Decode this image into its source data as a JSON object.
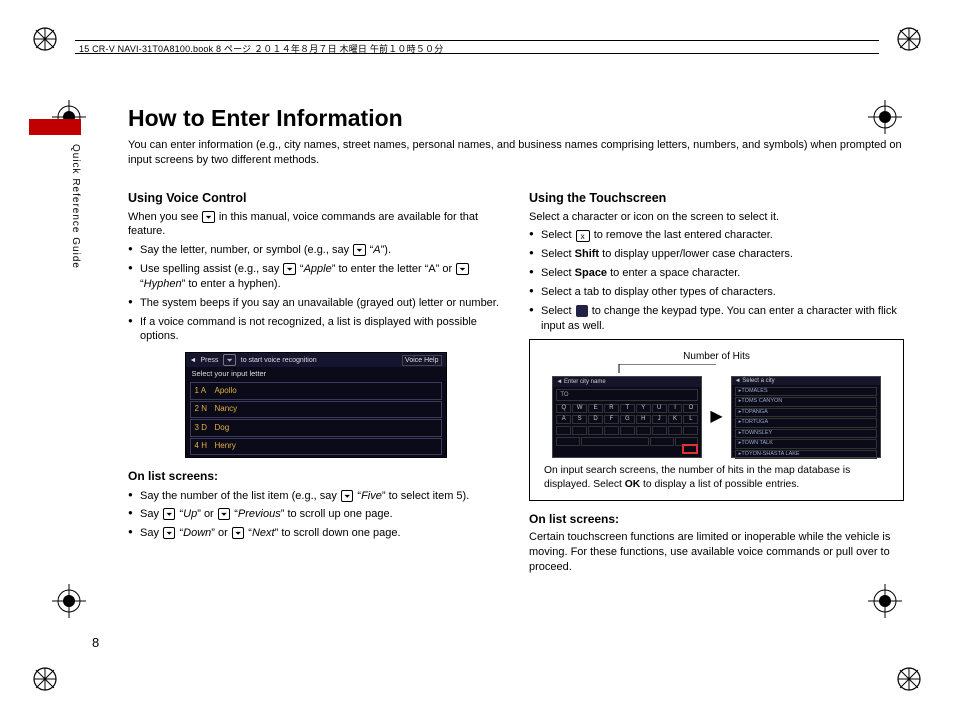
{
  "meta": {
    "running_head": "15 CR-V NAVI-31T0A8100.book  8 ページ  ２０１４年８月７日  木曜日  午前１０時５０分"
  },
  "sidebar": {
    "guide_label": "Quick Reference Guide"
  },
  "page_number": "8",
  "title": "How to Enter Information",
  "intro": "You can enter information (e.g., city names, street names, personal names, and business names comprising letters, numbers, and symbols) when prompted on input screens by two different methods.",
  "left": {
    "h2": "Using Voice Control",
    "lead_a": "When you see ",
    "lead_b": " in this manual, voice commands are available for that feature.",
    "b1_a": "Say the letter, number, or symbol (e.g., say ",
    "b1_b": " “",
    "b1_c": "A",
    "b1_d": "”).",
    "b2_a": "Use spelling assist (e.g., say ",
    "b2_b": " “",
    "b2_c": "Apple",
    "b2_d": "” to enter the letter “A” or ",
    "b2_e": " “",
    "b2_f": "Hyphen",
    "b2_g": "” to enter a hyphen).",
    "b3": "The system beeps if you say an unavailable (grayed out) letter or number.",
    "b4": "If a voice command is not recognized, a list is displayed with possible options.",
    "screenshot": {
      "header_a": "Press",
      "header_b": "to start voice recognition",
      "header_c": "Voice Help",
      "sub": "Select your input letter",
      "rows": [
        {
          "n": "1",
          "l": "A",
          "w": "Apollo"
        },
        {
          "n": "2",
          "l": "N",
          "w": "Nancy"
        },
        {
          "n": "3",
          "l": "D",
          "w": "Dog"
        },
        {
          "n": "4",
          "l": "H",
          "w": "Henry"
        }
      ]
    },
    "h3": "On list screens:",
    "c1_a": "Say the number of the list item (e.g., say ",
    "c1_b": " “",
    "c1_c": "Five",
    "c1_d": "” to select item 5).",
    "c2_a": "Say ",
    "c2_b": " “",
    "c2_c": "Up",
    "c2_d": "” or ",
    "c2_e": " “",
    "c2_f": "Previous",
    "c2_g": "” to scroll up one page.",
    "c3_a": "Say ",
    "c3_b": " “",
    "c3_c": "Down",
    "c3_d": "” or ",
    "c3_e": " “",
    "c3_f": "Next",
    "c3_g": "” to scroll down one page."
  },
  "right": {
    "h2": "Using the Touchscreen",
    "lead": "Select a character or icon on the screen to select it.",
    "b1_a": "Select ",
    "b1_key": "x",
    "b1_b": " to remove the last entered character.",
    "b2_a": "Select ",
    "b2_bold": "Shift",
    "b2_b": " to display upper/lower case characters.",
    "b3_a": "Select ",
    "b3_bold": "Space",
    "b3_b": " to enter a space character.",
    "b4": "Select a tab to display other types of characters.",
    "b5_a": "Select ",
    "b5_b": " to change the keypad type. You can enter a character with flick input as well.",
    "figlabel": "Number of Hits",
    "figcap_a": "On input search screens, the number of hits in the map database is displayed. Select ",
    "figcap_bold": "OK",
    "figcap_b": " to display a list of possible entries.",
    "scr1": {
      "top": "Enter city name",
      "search": "TO",
      "keys_r1": [
        "Q",
        "W",
        "E",
        "R",
        "T",
        "Y",
        "U",
        "I",
        "O"
      ],
      "keys_r2": [
        "A",
        "S",
        "D",
        "F",
        "G",
        "H",
        "J",
        "K",
        "L"
      ]
    },
    "scr2": {
      "top": "Select a city",
      "items": [
        "TOMALES",
        "TOMS CANYON",
        "TOPANGA",
        "TORTUGA",
        "TOWNSLEY",
        "TOWN TALK",
        "TOYON-SHASTA LAKE"
      ]
    },
    "h3": "On list screens:",
    "footer": "Certain touchscreen functions are limited or inoperable while the vehicle is moving. For these functions, use available voice commands or pull over to proceed."
  },
  "voice_icon": "⎙"
}
